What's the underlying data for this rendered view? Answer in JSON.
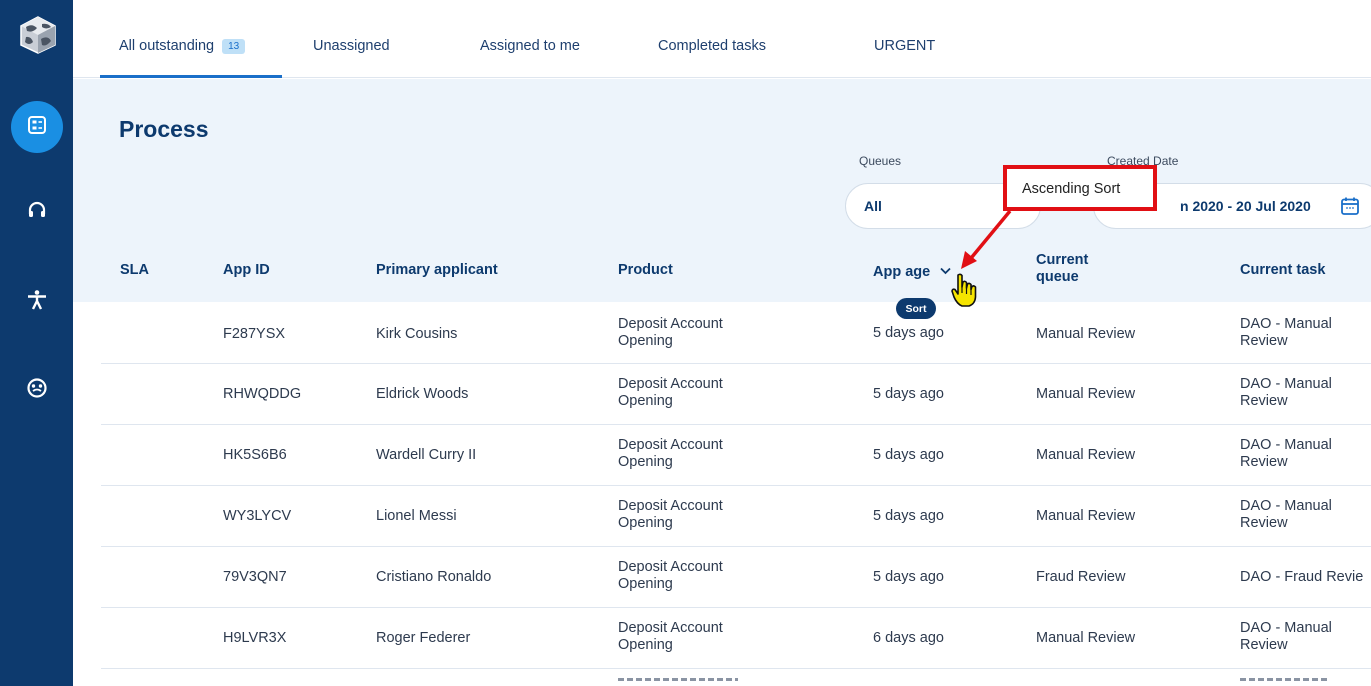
{
  "tabs": [
    {
      "label": "All outstanding",
      "badge": "13"
    },
    {
      "label": "Unassigned"
    },
    {
      "label": "Assigned to me"
    },
    {
      "label": "Completed tasks"
    },
    {
      "label": "URGENT"
    }
  ],
  "page": {
    "title": "Process"
  },
  "filters": {
    "queues_label": "Queues",
    "queues_value": "All",
    "created_label": "Created Date",
    "created_value": "n 2020 - 20 Jul 2020"
  },
  "columns": {
    "sla": "SLA",
    "app_id": "App ID",
    "primary_applicant": "Primary applicant",
    "product": "Product",
    "app_age": "App age",
    "current_queue": "Current queue",
    "current_task": "Current task"
  },
  "rows": [
    {
      "app_id": "F287YSX",
      "applicant": "Kirk Cousins",
      "product": "Deposit Account Opening",
      "age": "5 days ago",
      "queue": "Manual Review",
      "task": "DAO - Manual Review"
    },
    {
      "app_id": "RHWQDDG",
      "applicant": "Eldrick Woods",
      "product": "Deposit Account Opening",
      "age": "5 days ago",
      "queue": "Manual Review",
      "task": "DAO - Manual Review"
    },
    {
      "app_id": "HK5S6B6",
      "applicant": "Wardell Curry II",
      "product": "Deposit Account Opening",
      "age": "5 days ago",
      "queue": "Manual Review",
      "task": "DAO - Manual Review"
    },
    {
      "app_id": "WY3LYCV",
      "applicant": "Lionel Messi",
      "product": "Deposit Account Opening",
      "age": "5 days ago",
      "queue": "Manual Review",
      "task": "DAO - Manual Review"
    },
    {
      "app_id": "79V3QN7",
      "applicant": "Cristiano Ronaldo",
      "product": "Deposit Account Opening",
      "age": "5 days ago",
      "queue": "Fraud Review",
      "task": "DAO - Fraud Revie"
    },
    {
      "app_id": "H9LVR3X",
      "applicant": "Roger Federer",
      "product": "Deposit Account Opening",
      "age": "6 days ago",
      "queue": "Manual Review",
      "task": "DAO - Manual Review"
    }
  ],
  "annotation": {
    "callout": "Ascending Sort",
    "tooltip": "Sort"
  },
  "icons": {
    "logo": "globe-cube-logo",
    "nav": [
      "dashboard-icon",
      "headset-icon",
      "accessibility-icon",
      "palette-icon"
    ],
    "sort": "chevron-down-icon",
    "calendar": "calendar-icon",
    "pointer": "hand-pointer-icon"
  },
  "colors": {
    "sidebar": "#0d3a6e",
    "accent": "#1a8fe3",
    "band": "#edf4fb",
    "callout": "#e10f14",
    "pointer": "#f5e400"
  }
}
